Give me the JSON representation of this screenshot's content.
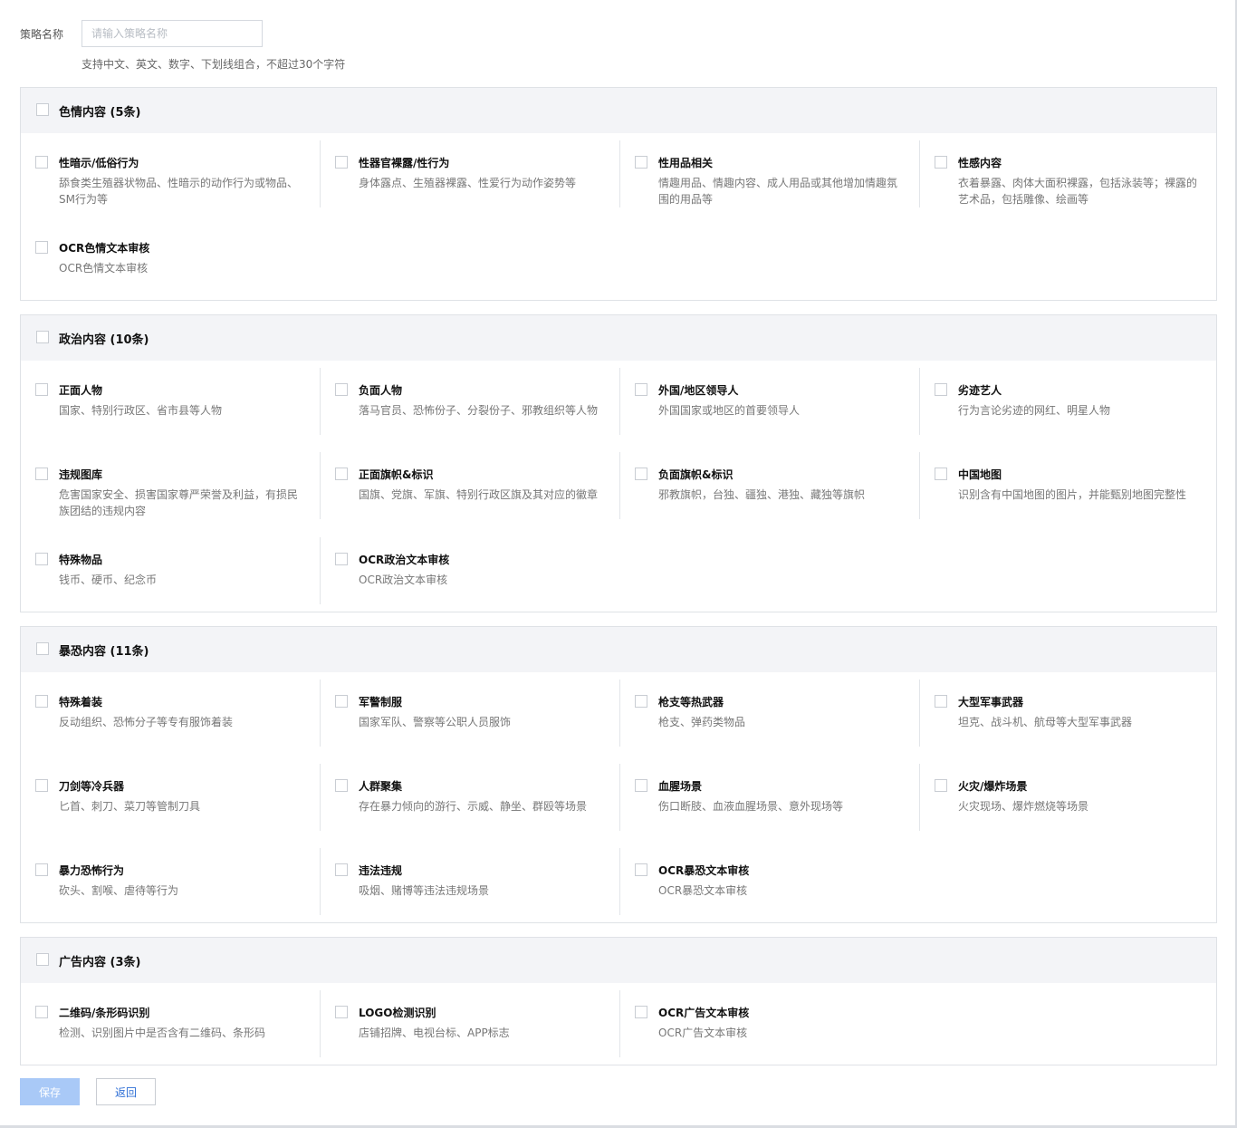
{
  "form": {
    "name_label": "策略名称",
    "name_placeholder": "请输入策略名称",
    "name_value": "",
    "hint": "支持中文、英文、数字、下划线组合，不超过30个字符"
  },
  "sections": [
    {
      "title": "色情内容 (5条)",
      "items": [
        {
          "title": "性暗示/低俗行为",
          "desc": "舔食类生殖器状物品、性暗示的动作行为或物品、SM行为等"
        },
        {
          "title": "性器官裸露/性行为",
          "desc": "身体露点、生殖器裸露、性爱行为动作姿势等"
        },
        {
          "title": "性用品相关",
          "desc": "情趣用品、情趣内容、成人用品或其他增加情趣氛围的用品等"
        },
        {
          "title": "性感内容",
          "desc": "衣着暴露、肉体大面积裸露，包括泳装等；裸露的艺术品，包括雕像、绘画等"
        },
        {
          "title": "OCR色情文本审核",
          "desc": "OCR色情文本审核"
        }
      ]
    },
    {
      "title": "政治内容 (10条)",
      "items": [
        {
          "title": "正面人物",
          "desc": "国家、特别行政区、省市县等人物"
        },
        {
          "title": "负面人物",
          "desc": "落马官员、恐怖份子、分裂份子、邪教组织等人物"
        },
        {
          "title": "外国/地区领导人",
          "desc": "外国国家或地区的首要领导人"
        },
        {
          "title": "劣迹艺人",
          "desc": "行为言论劣迹的网红、明星人物"
        },
        {
          "title": "违规图库",
          "desc": "危害国家安全、损害国家尊严荣誉及利益，有损民族团结的违规内容"
        },
        {
          "title": "正面旗帜&标识",
          "desc": "国旗、党旗、军旗、特别行政区旗及其对应的徽章"
        },
        {
          "title": "负面旗帜&标识",
          "desc": "邪教旗帜，台独、疆独、港独、藏独等旗帜"
        },
        {
          "title": "中国地图",
          "desc": "识别含有中国地图的图片，并能甄别地图完整性"
        },
        {
          "title": "特殊物品",
          "desc": "钱币、硬币、纪念币"
        },
        {
          "title": "OCR政治文本审核",
          "desc": "OCR政治文本审核"
        }
      ]
    },
    {
      "title": "暴恐内容 (11条)",
      "items": [
        {
          "title": "特殊着装",
          "desc": "反动组织、恐怖分子等专有服饰着装"
        },
        {
          "title": "军警制服",
          "desc": "国家军队、警察等公职人员服饰"
        },
        {
          "title": "枪支等热武器",
          "desc": "枪支、弹药类物品"
        },
        {
          "title": "大型军事武器",
          "desc": "坦克、战斗机、航母等大型军事武器"
        },
        {
          "title": "刀剑等冷兵器",
          "desc": "匕首、刺刀、菜刀等管制刀具"
        },
        {
          "title": "人群聚集",
          "desc": "存在暴力倾向的游行、示威、静坐、群殴等场景"
        },
        {
          "title": "血腥场景",
          "desc": "伤口断肢、血液血腥场景、意外现场等"
        },
        {
          "title": "火灾/爆炸场景",
          "desc": "火灾现场、爆炸燃烧等场景"
        },
        {
          "title": "暴力恐怖行为",
          "desc": "砍头、割喉、虐待等行为"
        },
        {
          "title": "违法违规",
          "desc": "吸烟、赌博等违法违规场景"
        },
        {
          "title": "OCR暴恐文本审核",
          "desc": "OCR暴恐文本审核"
        }
      ]
    },
    {
      "title": "广告内容 (3条)",
      "items": [
        {
          "title": "二维码/条形码识别",
          "desc": "检测、识别图片中是否含有二维码、条形码"
        },
        {
          "title": "LOGO检测识别",
          "desc": "店铺招牌、电视台标、APP标志"
        },
        {
          "title": "OCR广告文本审核",
          "desc": "OCR广告文本审核"
        }
      ]
    }
  ],
  "actions": {
    "save_label": "保存",
    "back_label": "返回"
  }
}
